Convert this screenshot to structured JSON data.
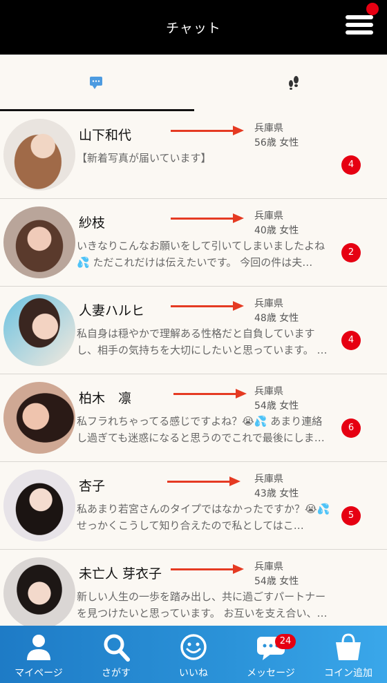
{
  "header": {
    "title": "チャット"
  },
  "tabs": [
    {
      "icon": "chat-bubble-icon",
      "active": true
    },
    {
      "icon": "footprints-icon",
      "active": false
    }
  ],
  "chats": [
    {
      "name": "山下和代",
      "prefecture": "兵庫県",
      "age_sex": "56歳 女性",
      "message": "【新着写真が届いています】",
      "unread": "4"
    },
    {
      "name": "紗枝",
      "prefecture": "兵庫県",
      "age_sex": "40歳 女性",
      "message": "いきなりこんなお願いをして引いてしまいましたよね💦 ただこれだけは伝えたいです。 今回の件は夫…",
      "unread": "2"
    },
    {
      "name": "人妻ハルヒ",
      "prefecture": "兵庫県",
      "age_sex": "48歳 女性",
      "message": "私自身は穏やかで理解ある性格だと自負していますし、相手の気持ちを大切にしたいと思っています。 …",
      "unread": "4"
    },
    {
      "name": "柏木　凛",
      "prefecture": "兵庫県",
      "age_sex": "54歳 女性",
      "message": "私フラれちゃってる感じですよね？😭💦 あまり連絡し過ぎても迷惑になると思うのでこれで最後にしま…",
      "unread": "6"
    },
    {
      "name": "杏子",
      "prefecture": "兵庫県",
      "age_sex": "43歳 女性",
      "message": "私あまり若宮さんのタイプではなかったですか？😭💦 せっかくこうして知り合えたので私としてはこ…",
      "unread": "5"
    },
    {
      "name": "未亡人 芽衣子",
      "prefecture": "兵庫県",
      "age_sex": "54歳 女性",
      "message": "新しい人生の一歩を踏み出し、共に過ごすパートナーを見つけたいと思っています。 お互いを支え合い、…",
      "unread": ""
    }
  ],
  "bottom_nav": [
    {
      "label": "マイページ",
      "icon": "person-icon"
    },
    {
      "label": "さがす",
      "icon": "search-icon"
    },
    {
      "label": "いいね",
      "icon": "smiley-icon"
    },
    {
      "label": "メッセージ",
      "icon": "message-icon",
      "badge": "24"
    },
    {
      "label": "コイン追加",
      "icon": "shopping-bag-icon"
    }
  ],
  "colors": {
    "header": "#000000",
    "accent_red": "#e60012",
    "arrow": "#e53a22",
    "nav_blue": "#2b93d9"
  }
}
